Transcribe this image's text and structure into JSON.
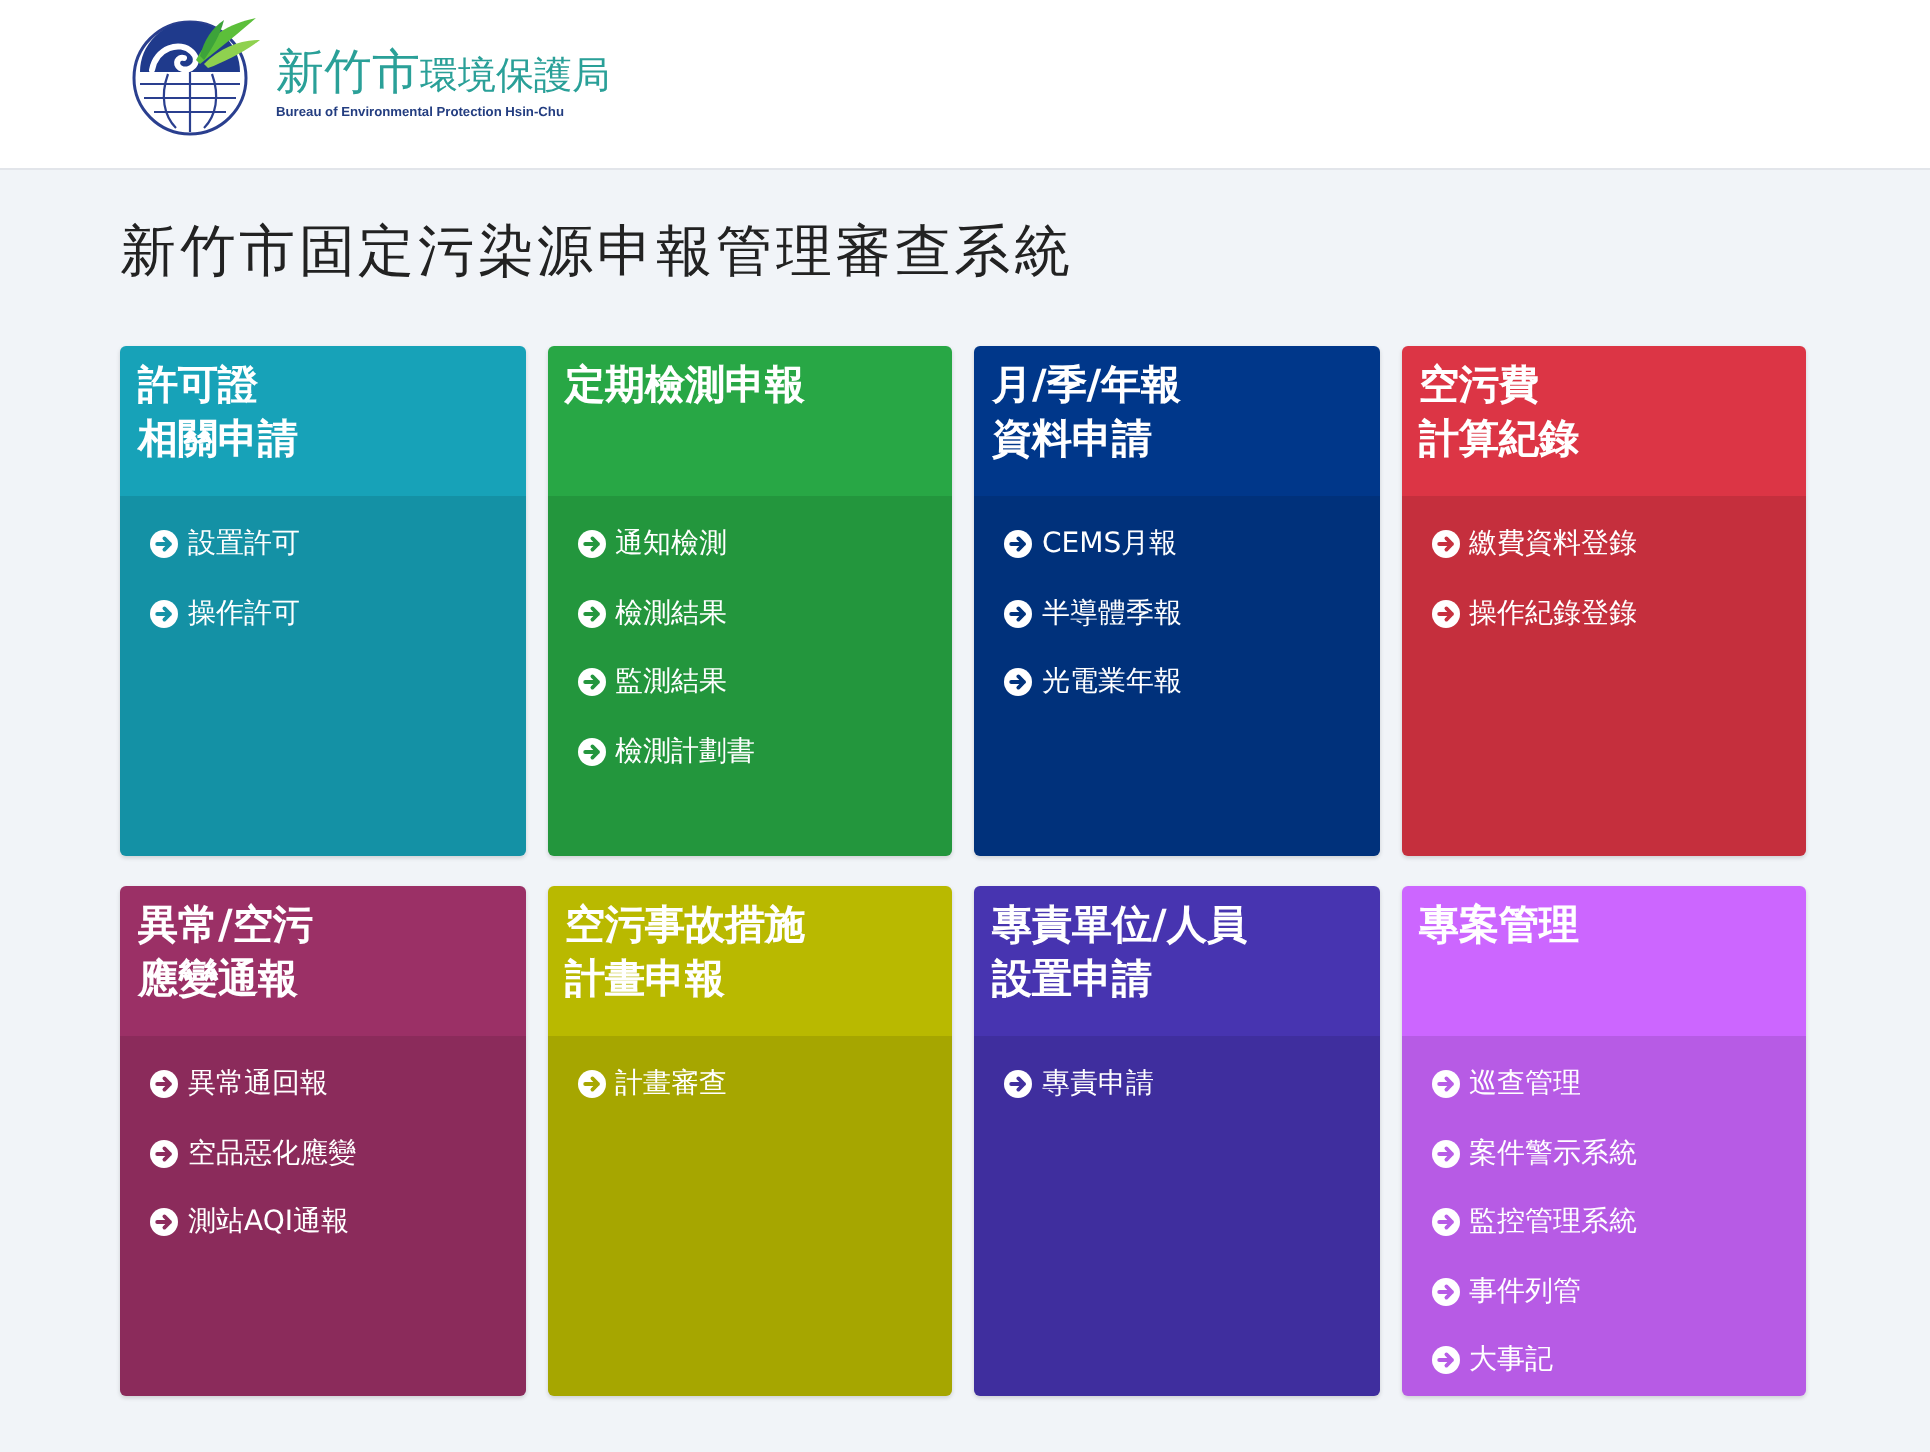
{
  "header": {
    "logo": {
      "city": "新竹市",
      "bureau": "環境保護局",
      "english": "Bureau of Environmental Protection Hsin-Chu"
    }
  },
  "page_title": "新竹市固定污染源申報管理審查系統",
  "cards": [
    {
      "title_lines": [
        "許可證",
        "相關申請"
      ],
      "color": "#17a2b8",
      "links": [
        "設置許可",
        "操作許可"
      ]
    },
    {
      "title_lines": [
        "定期檢測申報"
      ],
      "color": "#28a745",
      "links": [
        "通知檢測",
        "檢測結果",
        "監測結果",
        "檢測計劃書"
      ]
    },
    {
      "title_lines": [
        "月/季/年報",
        "資料申請"
      ],
      "color": "#00378a",
      "links": [
        "CEMS月報",
        "半導體季報",
        "光電業年報"
      ]
    },
    {
      "title_lines": [
        "空污費",
        "計算紀錄"
      ],
      "color": "#dc3545",
      "links": [
        "繳費資料登錄",
        "操作紀錄登錄"
      ]
    },
    {
      "title_lines": [
        "異常/空污",
        "應變通報"
      ],
      "color": "#9b3066",
      "links": [
        "異常通回報",
        "空品惡化應變",
        "測站AQI通報"
      ]
    },
    {
      "title_lines": [
        "空污事故措施",
        "計畫申報"
      ],
      "color": "#b9b900",
      "links": [
        "計畫審查"
      ]
    },
    {
      "title_lines": [
        "專責單位/人員",
        "設置申請"
      ],
      "color": "#4734b0",
      "links": [
        "專責申請"
      ]
    },
    {
      "title_lines": [
        "專案管理"
      ],
      "color": "#cc66ff",
      "links": [
        "巡查管理",
        "案件警示系統",
        "監控管理系統",
        "事件列管",
        "大事記"
      ]
    }
  ]
}
